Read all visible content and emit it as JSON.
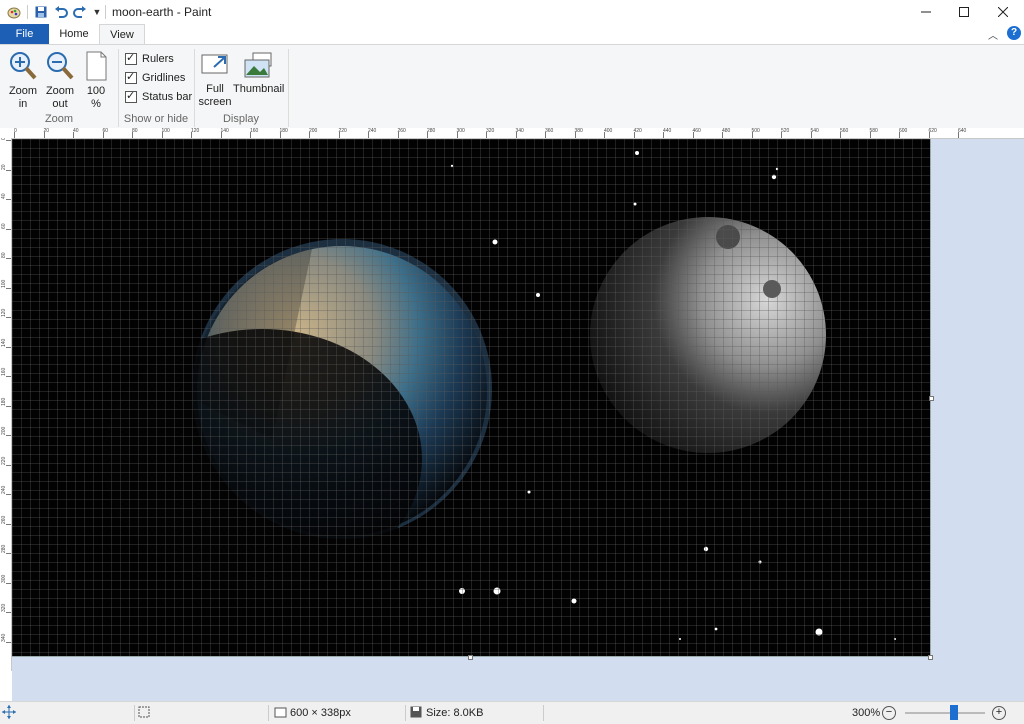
{
  "window": {
    "title": "moon-earth - Paint"
  },
  "ribbon": {
    "tabs": {
      "file": "File",
      "home": "Home",
      "view": "View"
    },
    "zoom": {
      "zoom_in": [
        "Zoom",
        "in"
      ],
      "zoom_out": [
        "Zoom",
        "out"
      ],
      "percent": [
        "100",
        "%"
      ],
      "group": "Zoom"
    },
    "show_hide": {
      "rulers": "Rulers",
      "gridlines": "Gridlines",
      "status_bar": "Status bar",
      "group": "Show or hide"
    },
    "display": {
      "full_screen": [
        "Full",
        "screen"
      ],
      "thumbnail": "Thumbnail",
      "group": "Display"
    }
  },
  "ruler": {
    "h_labels": [
      "0",
      "20",
      "40",
      "60",
      "80",
      "100",
      "120",
      "140",
      "160",
      "180",
      "200",
      "220",
      "240",
      "260",
      "280",
      "300",
      "320",
      "340",
      "360",
      "380",
      "400",
      "420",
      "440",
      "460",
      "480",
      "500",
      "520",
      "540",
      "560",
      "580",
      "600",
      "620",
      "640"
    ],
    "v_labels": [
      "0",
      "20",
      "40",
      "60",
      "80",
      "100",
      "120",
      "140",
      "160",
      "180",
      "200",
      "220",
      "240",
      "260",
      "280",
      "300",
      "320",
      "340",
      "360"
    ]
  },
  "status": {
    "dimensions": "600 × 338px",
    "size": "Size: 8.0KB",
    "zoom": "300%"
  },
  "colors": {
    "file_tab": "#1c5fb5",
    "workspace": "#d2deef",
    "accent": "#2b6cb0"
  }
}
